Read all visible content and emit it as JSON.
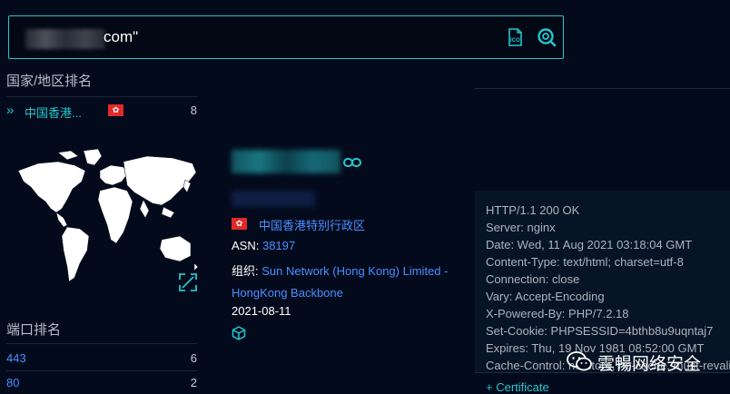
{
  "search": {
    "query_suffix": "com\""
  },
  "sidebar": {
    "country_title": "国家/地区排名",
    "countries": [
      {
        "name": "中国香港...",
        "count": "8"
      }
    ],
    "port_title": "端口排名",
    "ports": [
      {
        "port": "443",
        "count": "6"
      },
      {
        "port": "80",
        "count": "2"
      }
    ]
  },
  "host": {
    "region": "中国香港特别行政区",
    "asn_label": "ASN:",
    "asn": "38197",
    "org_label": "组织:",
    "org": "Sun Network (Hong Kong) Limited - HongKong Backbone",
    "date": "2021-08-11"
  },
  "response": {
    "lines": [
      "HTTP/1.1 200 OK",
      "Server: nginx",
      "Date: Wed, 11 Aug 2021 03:18:04 GMT",
      "Content-Type: text/html; charset=utf-8",
      "Connection: close",
      "Vary: Accept-Encoding",
      "X-Powered-By: PHP/7.2.18",
      "Set-Cookie: PHPSESSID=4bthb8u9uqntaj7",
      "Expires: Thu, 19 Nov 1981 08:52:00 GMT",
      "Cache-Control: no-store, no-cache, must-revalidate"
    ],
    "certificate_label": "Certificate"
  },
  "watermark": {
    "text": "雲暢网络安全"
  },
  "colors": {
    "accent": "#21c9cf",
    "link": "#4a90ff",
    "background": "#030a1c",
    "flag": "#e02a2a"
  },
  "icons": [
    "ico-search-icon",
    "scan-icon",
    "chevron-right-icon",
    "hk-flag-icon",
    "world-map",
    "expand-icon",
    "link-icon",
    "cube-icon",
    "plus-icon",
    "wechat-icon"
  ]
}
